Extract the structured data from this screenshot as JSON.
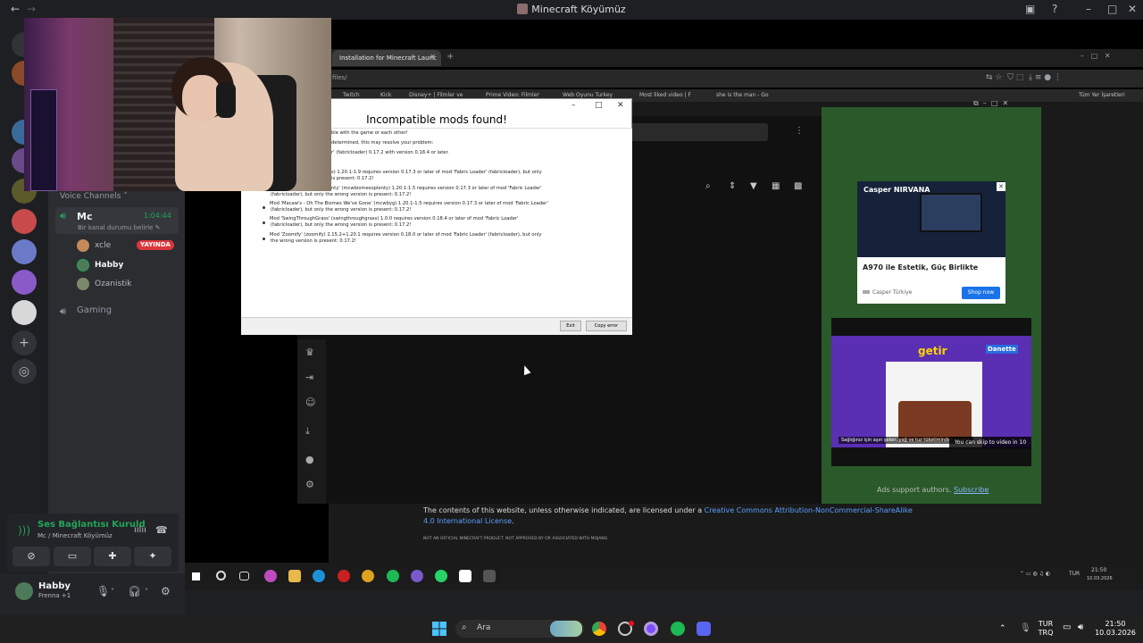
{
  "window": {
    "title": "Minecraft Köyümüz"
  },
  "discord": {
    "voice_header": "Voice Channels",
    "channel": {
      "name": "Mc",
      "time": "1:04:44",
      "status_prompt": "Bir kanal durumu belirle"
    },
    "members": [
      {
        "name": "xcle",
        "badge": "YAYINDA"
      },
      {
        "name": "Habby",
        "badge": ""
      },
      {
        "name": "Ozanistik",
        "badge": ""
      }
    ],
    "other_channel": "Gaming",
    "voice_panel": {
      "title": "Ses Bağlantısı Kuruld",
      "subtitle": "Mc / Minecraft Köyümüz"
    },
    "user": {
      "name": "Habby",
      "status": "Frenna +1"
    }
  },
  "stream": {
    "browser_tab": "Installation for Minecraft Launc",
    "url": "files/",
    "bookmarks": [
      "Twitch",
      "Kick",
      "Disney+ | Filmler ve",
      "Prime Video: Filmler",
      "Web Oyunu Turkey",
      "Most liked video | F",
      "she is the man - Go"
    ],
    "bookmarks_right": "Tüm Yer İşaretleri",
    "dialog": {
      "title": "Incompatible mods found!",
      "lines": [
        "ble with the game or each other!",
        "determined, this may resolve your problem:",
        "r' (fabricloader) 0.17.2 with version 0.18.4 or later.",
        "s) 1.20.1-1.9 requires version 0.17.3 or later of mod 'Fabric Loader' (fabricloader), but only",
        "is present: 0.17.2!",
        "nty' (mcwbiomesoplenty) 1.20.1-1.5 requires version 0.17.3 or later of mod 'Fabric Loader'",
        "(fabricloader), but only the wrong version is present: 0.17.2!",
        "Mod 'Macaw's - Oh The Biomes We've Gone' (mcwbyg) 1.20.1-1.5 requires version 0.17.3 or later of mod 'Fabric Loader'",
        "(fabricloader), but only the wrong version is present: 0.17.2!",
        "Mod 'SwingThroughGrass' (swingthroughgrass) 1.0.0 requires version 0.18.4 or later of mod 'Fabric Loader'",
        "(fabricloader), but only the wrong version is present: 0.17.2!",
        "Mod 'Zoomify' (zoomify) 2.15.2+1.20.1 requires version 0.18.0 or later of mod 'Fabric Loader' (fabricloader), but only",
        "the wrong version is present: 0.17.2!"
      ],
      "exit_label": "Exit",
      "copy_label": "Copy error"
    },
    "ad1": {
      "brand": "Casper NIRVANA",
      "title": "A970 ile Estetik, Güç Birlikte",
      "source": "Casper Türkiye",
      "cta": "Shop now"
    },
    "ad2": {
      "logo": "getir",
      "brand": "Danette",
      "caption": "Sağlığınız için aşırı şeker, yağ ve tuz tüketiminden kaçının",
      "skip": "You can skip to video in 10"
    },
    "ads_support": "Ads support authors.",
    "subscribe": "Subscribe",
    "license_prefix": "The contents of this website, unless otherwise indicated, are licensed under a ",
    "license_link": "Creative Commons Attribution-NonCommercial-ShareAlike 4.0 International License",
    "license_suffix": ".",
    "not_official": "NOT AN OFFICIAL MINECRAFT PRODUCT. NOT APPROVED BY OR ASSOCIATED WITH MOJANG.",
    "tray": {
      "lang": "TUR",
      "time": "21:50",
      "date": "10.03.2026"
    }
  },
  "taskbar": {
    "search_placeholder": "Ara",
    "lang_top": "TUR",
    "lang_bottom": "TRQ",
    "time": "21:50",
    "date": "10.03.2026"
  },
  "colors": {
    "discord_green": "#23a559",
    "live_red": "#da373c",
    "link_blue": "#5aa0ff"
  }
}
